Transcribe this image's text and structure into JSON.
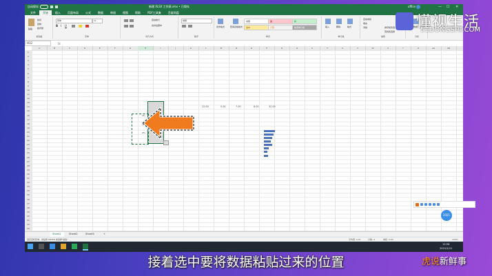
{
  "titlebar": {
    "autosave": "自动保存",
    "title": "新建 XLSX 工作表.xlsx • 已保存",
    "user": "office",
    "minimize": "—",
    "maximize": "☐",
    "close": "✕"
  },
  "ribbon_tabs": [
    "文件",
    "开始",
    "插入",
    "页面布局",
    "公式",
    "数据",
    "审阅",
    "视图",
    "帮助",
    "PDF工具集",
    "百度网盘"
  ],
  "ribbon": {
    "clipboard": {
      "paste": "粘贴",
      "cut": "剪切",
      "copy": "复制",
      "format_painter": "格式刷",
      "label": "剪贴板"
    },
    "font": {
      "name": "宋体",
      "size": "11",
      "label": "字体"
    },
    "alignment": {
      "wrap": "自动换行",
      "merge": "合并后居中",
      "label": "对齐方式"
    },
    "number": {
      "format": "常规",
      "label": "数字"
    },
    "styles": {
      "cond": "条件格式",
      "table": "套用表格格式",
      "cell_styles": [
        "常规",
        "差",
        "好",
        "适中",
        "计算",
        "检查单元格"
      ],
      "label": "样式"
    },
    "cells": {
      "insert": "插入",
      "delete": "删除",
      "format": "格式",
      "label": "单元格"
    },
    "editing": {
      "autosum": "自动求和",
      "fill": "填充",
      "clear": "清除",
      "sort": "排序和筛选",
      "find": "查找和选择",
      "label": "编辑"
    },
    "analysis": {
      "analyze": "分析数据",
      "label": "分析"
    }
  },
  "formula": {
    "namebox": "H12",
    "fx": "fx"
  },
  "columns": [
    "A",
    "B",
    "C",
    "D",
    "E",
    "F",
    "G",
    "H",
    "I",
    "J",
    "K",
    "L",
    "M",
    "N",
    "O",
    "P",
    "Q",
    "R",
    "S",
    "T",
    "U",
    "V",
    "W",
    "X",
    "Y",
    "Z",
    "AA",
    "AB"
  ],
  "rows": [
    "1",
    "2",
    "3",
    "4",
    "5",
    "6",
    "7",
    "8",
    "9",
    "10",
    "11",
    "12",
    "13",
    "14",
    "15",
    "16",
    "17",
    "18",
    "19",
    "20",
    "21",
    "22",
    "23",
    "24",
    "25",
    "26",
    "27",
    "28",
    "29",
    "30",
    "31",
    "32",
    "33",
    "34",
    "35",
    "36",
    "37",
    "38",
    "39",
    "40",
    "41",
    "42",
    "43"
  ],
  "row_values": [
    "12.00",
    "5.00",
    "7.00",
    "8.00",
    "32.00"
  ],
  "pct_values": [
    "0%",
    "0%",
    "0%"
  ],
  "sheet_tabs": [
    "Sheet1",
    "Sheet2",
    "Sheet3"
  ],
  "add_sheet": "+",
  "status": {
    "left": "选定目标区域，然后按 ENTER 或选择\"粘贴\"",
    "avg": "平均值: 0.01",
    "count": "计数: 4",
    "sum": "求和: 0.04",
    "zoom": "100%"
  },
  "taskbar": {
    "time": "13:58",
    "date": "2021/1/11"
  },
  "ime": {
    "badge": "2021"
  },
  "caption": "接着选中要将数据粘贴过来的位置",
  "watermark_top": {
    "big": "懂视生活",
    "small": "51DONGSHI.COM"
  },
  "watermark_bottom": {
    "a": "虎说",
    "b": "新鲜事"
  },
  "colors": {
    "excel_green": "#217346",
    "accent_orange": "#f07a1e",
    "bar_blue": "#4a70b8"
  }
}
